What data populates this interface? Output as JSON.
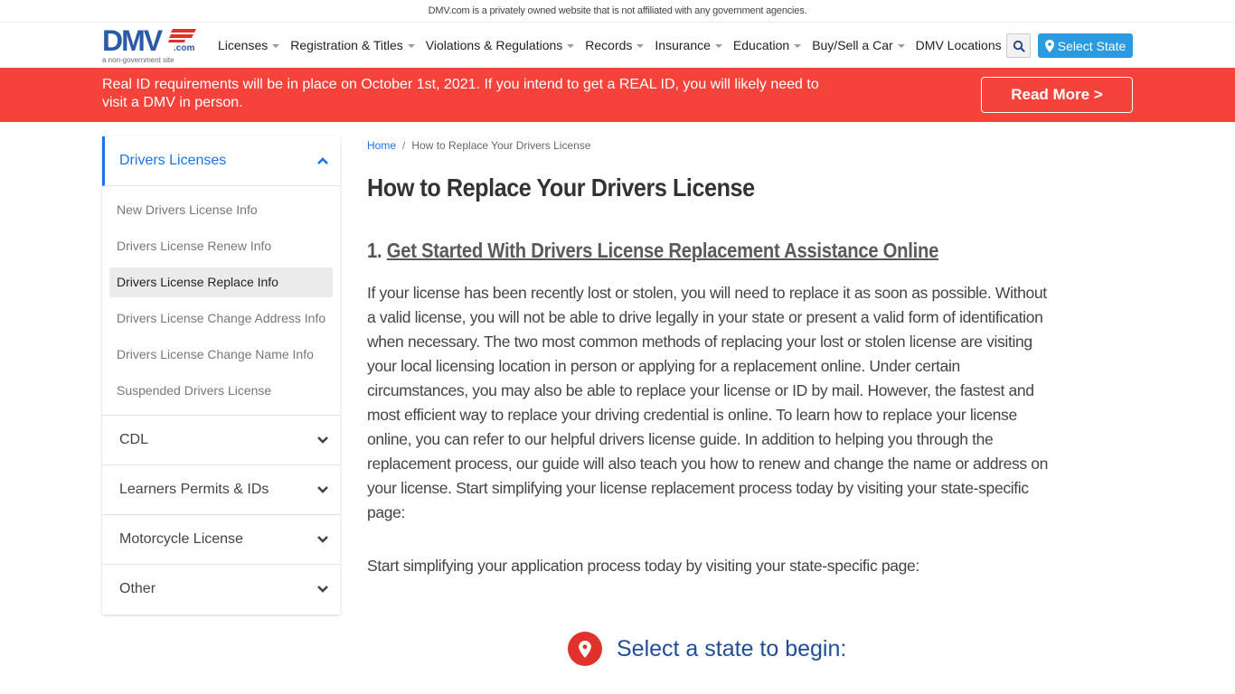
{
  "disclaimer": "DMV.com is a privately owned website that is not affiliated with any government agencies.",
  "logo": {
    "brand": "DMV",
    "suffix": ".com",
    "tagline": "a non-government site"
  },
  "nav": {
    "items": [
      {
        "label": "Licenses",
        "dropdown": true
      },
      {
        "label": "Registration & Titles",
        "dropdown": true
      },
      {
        "label": "Violations & Regulations",
        "dropdown": true
      },
      {
        "label": "Records",
        "dropdown": true
      },
      {
        "label": "Insurance",
        "dropdown": true
      },
      {
        "label": "Education",
        "dropdown": true
      },
      {
        "label": "Buy/Sell a Car",
        "dropdown": true
      },
      {
        "label": "DMV Locations",
        "dropdown": false
      }
    ],
    "search_icon": "search-icon",
    "select_state_label": "Select State"
  },
  "alert": {
    "text": "Real ID requirements will be in place on October 1st, 2021. If you intend to get a REAL ID, you will likely need to visit a DMV in person.",
    "button_label": "Read More >"
  },
  "sidebar": {
    "active_section": "Drivers Licenses",
    "links": [
      {
        "label": "New Drivers License Info",
        "active": false
      },
      {
        "label": "Drivers License Renew Info",
        "active": false
      },
      {
        "label": "Drivers License Replace Info",
        "active": true
      },
      {
        "label": "Drivers License Change Address Info",
        "active": false
      },
      {
        "label": "Drivers License Change Name Info",
        "active": false
      },
      {
        "label": "Suspended Drivers License",
        "active": false
      }
    ],
    "sections": [
      "CDL",
      "Learners Permits & IDs",
      "Motorcycle License",
      "Other"
    ]
  },
  "breadcrumb": {
    "home": "Home",
    "separator": "/",
    "current": "How to Replace Your Drivers License"
  },
  "main": {
    "title": "How to Replace Your Drivers License",
    "section_number": "1.",
    "section_link": "Get Started With Drivers License Replacement Assistance Online",
    "paragraph1": "If your license has been recently lost or stolen, you will need to replace it as soon as possible. Without a valid license, you will not be able to drive legally in your state or present a valid form of identification when necessary. The two most common methods of replacing your lost or stolen license are visiting your local licensing location in person or applying for a replacement online. Under certain circumstances, you may also be able to replace your license or ID by mail. However, the fastest and most efficient way to replace your driving credential is online. To learn how to replace your license online, you can refer to our helpful drivers license guide. In addition to helping you through the replacement process, our guide will also teach you how to renew and change the name or address on your license. Start simplifying your license replacement process today by visiting your state-specific page:",
    "paragraph2": "Start simplifying your application process today by visiting your state-specific page:",
    "state_cta": "Select a state to begin:"
  },
  "colors": {
    "brand_blue": "#2b5aa8",
    "link_blue": "#1a73e8",
    "alert_red": "#f5423a",
    "button_blue": "#2a9be0",
    "pin_red": "#e0322a"
  }
}
